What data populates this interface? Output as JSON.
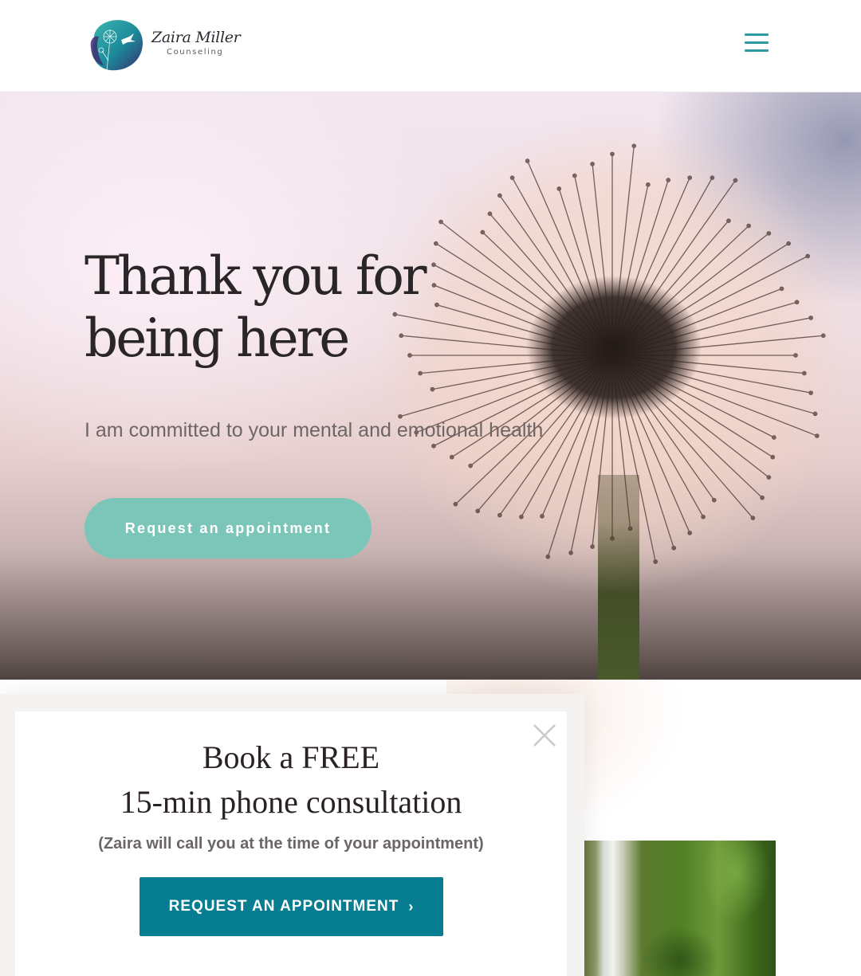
{
  "header": {
    "logo_name": "Zaira Miller",
    "logo_sub": "Counseling",
    "menu_icon": "hamburger-menu-icon"
  },
  "hero": {
    "title_line1": "Thank you for",
    "title_line2": "being here",
    "subtitle": "I am committed to your mental and emotional health",
    "button_label": "Request an appointment"
  },
  "popup": {
    "title_line1": "Book a FREE",
    "title_line2": "15-min phone consultation",
    "note": "(Zaira will call you at the time of your appointment)",
    "button_label": "REQUEST AN APPOINTMENT",
    "button_icon": "chevron-right-icon",
    "close_icon": "close-icon"
  },
  "colors": {
    "accent_teal": "#2e9aa3",
    "hero_button": "#7cc6b9",
    "popup_button": "#067d91",
    "title_text": "#2a2628"
  }
}
